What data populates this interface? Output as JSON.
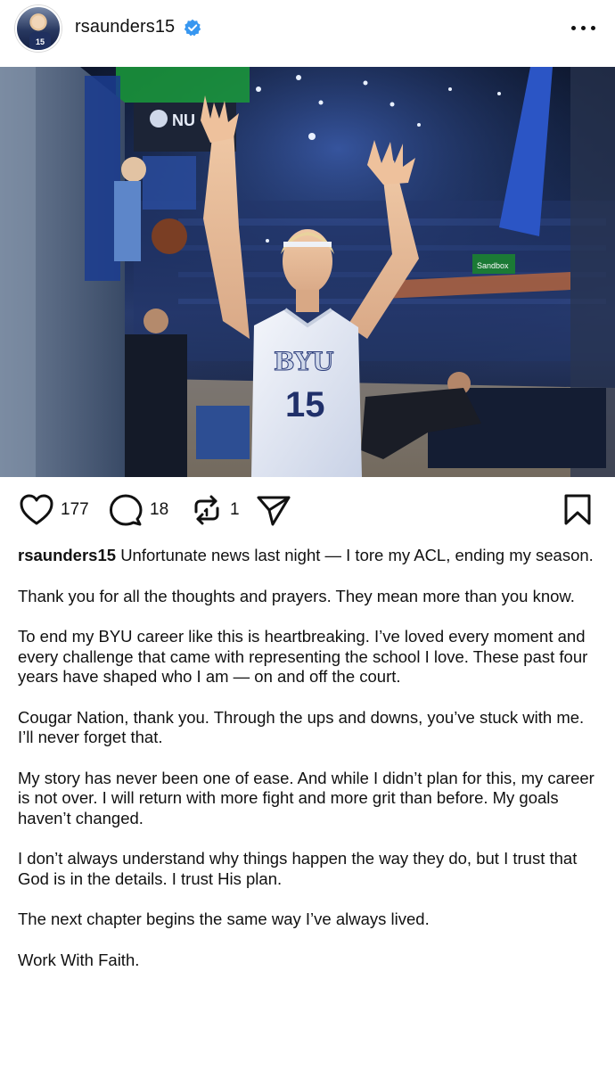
{
  "post": {
    "username": "rsaunders15",
    "avatar_jersey": "15",
    "verified": true
  },
  "photo": {
    "jersey_text": "BYU",
    "jersey_number": "15",
    "scoreboard_text": "NU",
    "sponsor_text": "Sandbox"
  },
  "actions": {
    "likes": "177",
    "comments": "18",
    "reposts": "1"
  },
  "caption": {
    "author": "rsaunders15",
    "paragraphs": [
      "Unfortunate news last night — I tore my ACL, ending my season.",
      "Thank you for all the thoughts and prayers. They mean more than you know.",
      "To end my BYU career like this is heartbreaking. I’ve loved every moment and every challenge that came with representing the school I love. These past four years have shaped who I am — on and off the court.",
      "Cougar Nation, thank you. Through the ups and downs, you’ve stuck with me. I’ll never forget that.",
      "My story has never been one of ease. And while I didn’t plan for this, my career is not over. I will return with more fight and more grit than before. My goals haven’t changed.",
      "I don’t always understand why things happen the way they do, but I trust that God is in the details. I trust His plan.",
      "The next chapter begins the same way I’ve always lived.",
      "Work With Faith."
    ]
  },
  "colors": {
    "verified_blue": "#3897f0",
    "text": "#111111",
    "background": "#ffffff"
  }
}
